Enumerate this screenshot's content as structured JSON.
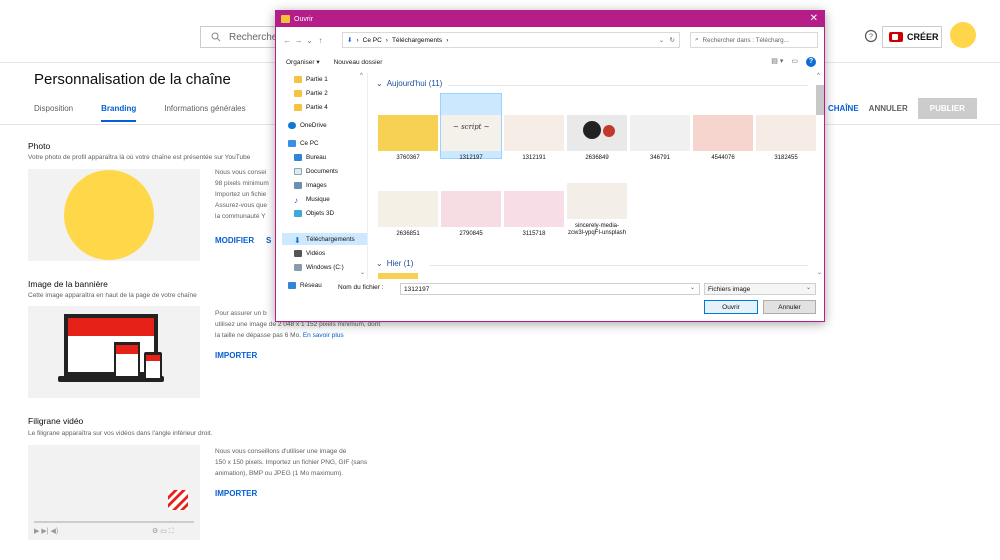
{
  "studio": {
    "search_placeholder": "Rechercher",
    "create_label": "CRÉER",
    "page_title": "Personnalisation de la chaîne",
    "tabs": [
      {
        "label": "Disposition"
      },
      {
        "label": "Branding"
      },
      {
        "label": "Informations générales"
      }
    ],
    "view_channel_label": "CHAÎNE",
    "cancel_label": "ANNULER",
    "publish_label": "PUBLIER",
    "photo": {
      "title": "Photo",
      "desc": "Votre photo de profil apparaîtra là où votre chaîne est présentée sur YouTube",
      "lines": [
        "Nous vous consei",
        "98 pixels minimum",
        "Importez un fichie",
        "Assurez-vous que",
        "la communauté Y"
      ],
      "modify_label": "MODIFIER",
      "delete_label": "S"
    },
    "banner": {
      "title": "Image de la bannière",
      "desc": "Cette image apparaîtra en haut de la page de votre chaîne",
      "line1": "Pour assurer un b",
      "line2": "utilisez une image de 2 048 x 1 152 pixels minimum, dont",
      "line3": "la taille ne dépasse pas 6 Mo.",
      "learn_more": "En savoir plus",
      "import_label": "IMPORTER"
    },
    "watermark": {
      "title": "Filigrane vidéo",
      "desc": "Le filigrane apparaîtra sur vos vidéos dans l'angle inférieur droit.",
      "line1": "Nous vous conseillons d'utiliser une image de",
      "line2": "150 x 150 pixels. Importez un fichier PNG, GIF (sans",
      "line3": "animation), BMP ou JPEG (1 Mo maximum).",
      "import_label": "IMPORTER"
    }
  },
  "dialog": {
    "title": "Ouvrir",
    "path": [
      "Ce PC",
      "Téléchargements"
    ],
    "search_placeholder": "Rechercher dans : Télécharg...",
    "organize_label": "Organiser ▾",
    "new_folder_label": "Nouveau dossier",
    "nav_items": [
      {
        "label": "Partie 1",
        "icon": "folder-icon"
      },
      {
        "label": "Partie 2",
        "icon": "folder-icon"
      },
      {
        "label": "Partie 4",
        "icon": "folder-icon"
      },
      {
        "label": "OneDrive",
        "icon": "cloud-icon"
      },
      {
        "label": "Ce PC",
        "icon": "computer-icon"
      },
      {
        "label": "Bureau",
        "icon": "desktop-icon"
      },
      {
        "label": "Documents",
        "icon": "documents-icon"
      },
      {
        "label": "Images",
        "icon": "images-icon"
      },
      {
        "label": "Musique",
        "icon": "music-icon"
      },
      {
        "label": "Objets 3D",
        "icon": "objects3d-icon"
      },
      {
        "label": "Téléchargements",
        "icon": "download-icon"
      },
      {
        "label": "Vidéos",
        "icon": "videos-icon"
      },
      {
        "label": "Windows (C:)",
        "icon": "drive-icon"
      },
      {
        "label": "Réseau",
        "icon": "network-icon"
      }
    ],
    "group_today": "Aujourd'hui (11)",
    "group_yesterday": "Hier (1)",
    "files": [
      {
        "name": "3760367",
        "color": "#f7d154"
      },
      {
        "name": "1312197",
        "color": "#f4f0ea"
      },
      {
        "name": "1312191",
        "color": "#f6ede6"
      },
      {
        "name": "2636849",
        "color": "#e9e9e9"
      },
      {
        "name": "346791",
        "color": "#f0f0f0"
      },
      {
        "name": "4544076",
        "color": "#f6d5cf"
      },
      {
        "name": "3182455",
        "color": "#f7ebe6"
      },
      {
        "name": "2636851",
        "color": "#f4f0e6"
      },
      {
        "name": "2790845",
        "color": "#f6dde4"
      },
      {
        "name": "3115718",
        "color": "#f7dde6"
      },
      {
        "name": "sincerely-media-zcw3l-ypqFI-unsplash",
        "color": "#f3efe8"
      }
    ],
    "filename_label": "Nom du fichier :",
    "filename_value": "1312197",
    "filetype_value": "Fichiers image",
    "open_label": "Ouvrir",
    "cancel_label": "Annuler",
    "accent_color": "#b51d88"
  }
}
